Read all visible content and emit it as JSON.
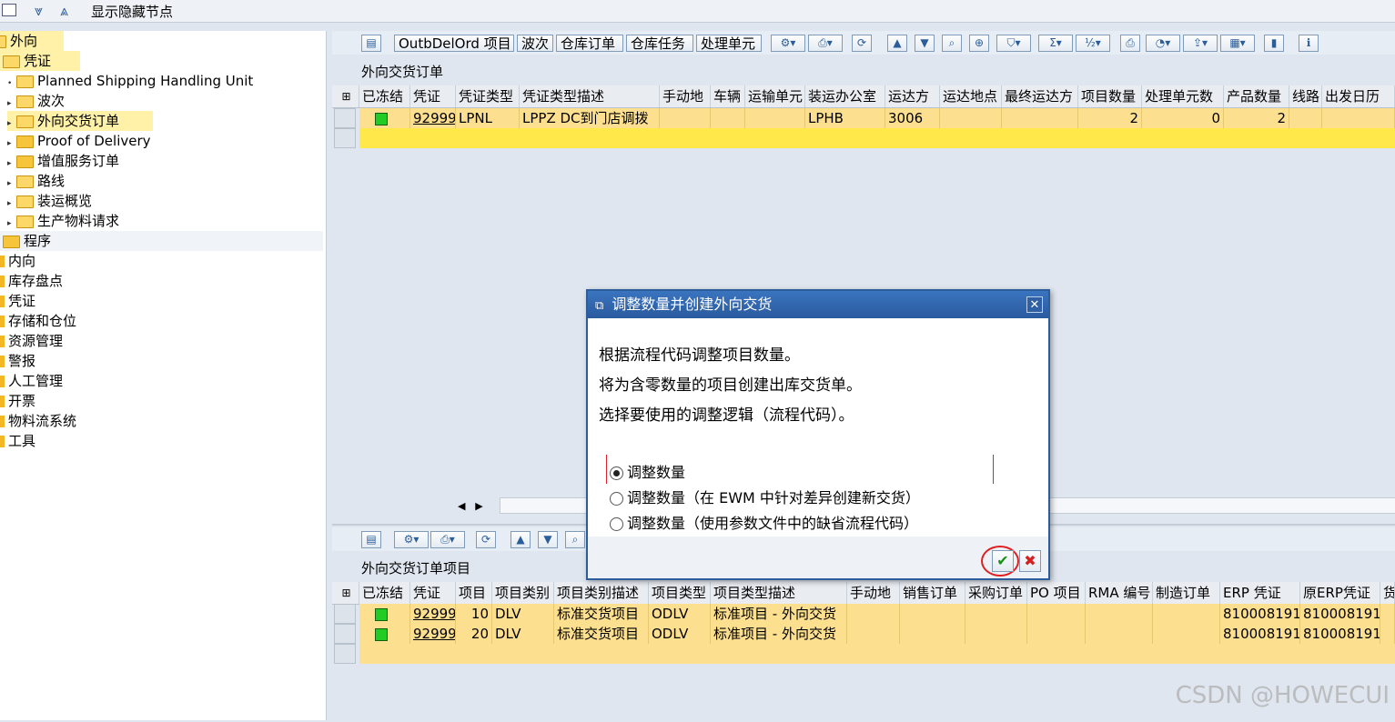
{
  "top_toolbar": {
    "show_hidden_nodes": "显示隐藏节点"
  },
  "tree": {
    "root": "外向",
    "documents": "凭证",
    "children": [
      "Planned Shipping Handling Unit",
      "波次",
      "外向交货订单",
      "Proof of Delivery",
      "增值服务订单",
      "路线",
      "装运概览",
      "生产物料请求"
    ],
    "program": "程序",
    "top_level": [
      "内向",
      "库存盘点",
      "凭证",
      "存储和仓位",
      "资源管理",
      "警报",
      "人工管理",
      "开票",
      "物料流系统",
      "工具"
    ]
  },
  "upper_pane": {
    "buttons": [
      "OutbDelOrd 项目",
      "波次",
      "仓库订单",
      "仓库任务",
      "处理单元"
    ],
    "title": "外向交货订单",
    "columns": [
      "已冻结",
      "凭证",
      "凭证类型",
      "凭证类型描述",
      "手动地",
      "车辆",
      "运输单元",
      "装运办公室",
      "运达方",
      "运达地点",
      "最终运达方",
      "项目数量",
      "处理单元数",
      "产品数量",
      "线路",
      "出发日历"
    ],
    "row": {
      "doc": "92999",
      "doc_type": "LPNL",
      "doc_type_desc": "LPPZ DC到门店调拨",
      "ship_office": "LPHB",
      "ship_to": "3006",
      "item_qty": "2",
      "hu_count": "0",
      "product_qty": "2"
    }
  },
  "lower_pane": {
    "title": "外向交货订单项目",
    "columns": [
      "已冻结",
      "凭证",
      "项目",
      "项目类别",
      "项目类别描述",
      "项目类型",
      "项目类型描述",
      "手动地",
      "销售订单",
      "采购订单",
      "PO 项目",
      "RMA 编号",
      "制造订单",
      "ERP 凭证",
      "原ERP凭证",
      "货"
    ],
    "rows": [
      {
        "doc": "92999",
        "item": "10",
        "cat": "DLV",
        "cat_desc": "标准交货项目",
        "type": "ODLV",
        "type_desc": "标准项目 - 外向交货",
        "erp": "810008191",
        "orig_erp": "810008191"
      },
      {
        "doc": "92999",
        "item": "20",
        "cat": "DLV",
        "cat_desc": "标准交货项目",
        "type": "ODLV",
        "type_desc": "标准项目 - 外向交货",
        "erp": "810008191",
        "orig_erp": "810008191"
      }
    ]
  },
  "dialog": {
    "title": "调整数量并创建外向交货",
    "lines": [
      "根据流程代码调整项目数量。",
      "将为含零数量的项目创建出库交货单。",
      "选择要使用的调整逻辑（流程代码）。"
    ],
    "options": [
      "调整数量",
      "调整数量（在 EWM 中针对差异创建新交货）",
      "调整数量（使用参数文件中的缺省流程代码）"
    ],
    "selected_option": 0,
    "ok_symbol": "✔",
    "cancel_symbol": "✖",
    "close_symbol": "✕"
  },
  "watermark": "CSDN @HOWECUI",
  "colors": {
    "row_highlight": "#fde08f",
    "dialog_title": "#2a5a9e",
    "accent_red": "#e02020"
  }
}
